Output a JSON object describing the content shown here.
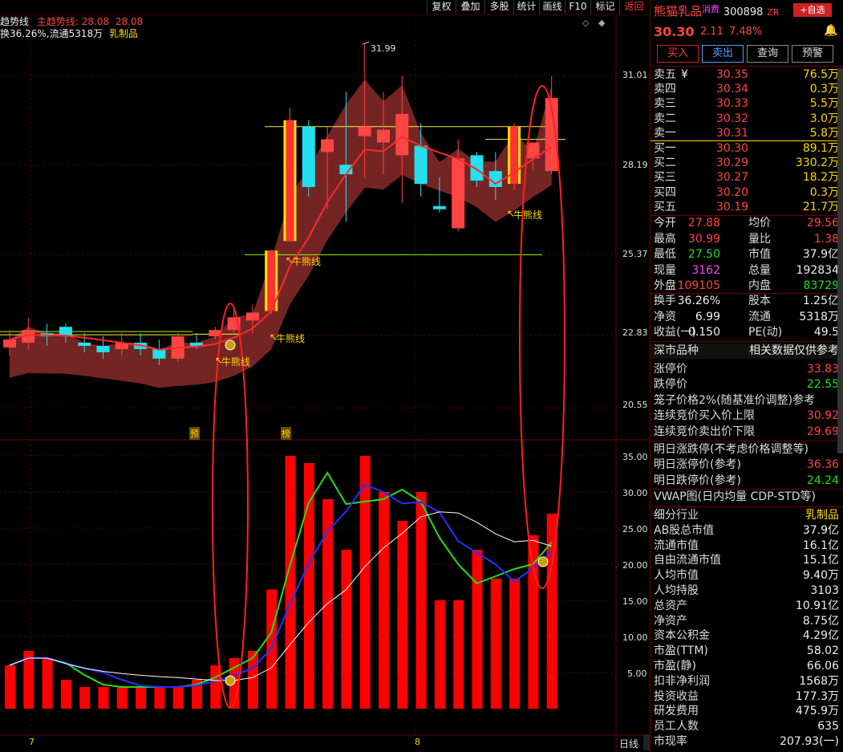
{
  "toolbar": {
    "items": [
      "复权",
      "叠加",
      "多股",
      "统计",
      "画线",
      "F10",
      "标记",
      "返回"
    ]
  },
  "indicator": {
    "main_name": "趋势线",
    "main_label": "主趋势线",
    "main_value": "28.08",
    "second_value": "28.08",
    "line2": "换36.26%,流通5318万",
    "sector": "乳制品"
  },
  "price_axis": [
    "31.01",
    "28.19",
    "25.37",
    "22.83",
    "20.55"
  ],
  "vol_axis": [
    "35.00",
    "30.00",
    "25.00",
    "20.00",
    "15.00",
    "10.00",
    "5.00"
  ],
  "chart_annotations": {
    "high": "31.99",
    "bull1": "牛熊线",
    "bull2": "牛熊线",
    "bull3": "牛熊线",
    "bull4": "牛熊线",
    "tag_yu": "预",
    "tag_bang": "榜",
    "month7": "7",
    "month8": "8",
    "period": "日线"
  },
  "stock": {
    "name": "熊猫乳品",
    "tag": "消费",
    "code": "300898",
    "zr": "ZR",
    "add_label": "+自选",
    "price": "30.30",
    "change": "2.11",
    "pct": "7.48%"
  },
  "actions": [
    "买入",
    "卖出",
    "查询",
    "预警"
  ],
  "sell": [
    {
      "l": "卖五",
      "p": "30.35",
      "v": "76.5万",
      "y": "¥"
    },
    {
      "l": "卖四",
      "p": "30.34",
      "v": "0.3万"
    },
    {
      "l": "卖三",
      "p": "30.33",
      "v": "5.5万"
    },
    {
      "l": "卖二",
      "p": "30.32",
      "v": "3.0万"
    },
    {
      "l": "卖一",
      "p": "30.31",
      "v": "5.8万"
    }
  ],
  "buy": [
    {
      "l": "买一",
      "p": "30.30",
      "v": "89.1万"
    },
    {
      "l": "买二",
      "p": "30.29",
      "v": "330.2万"
    },
    {
      "l": "买三",
      "p": "30.27",
      "v": "18.2万"
    },
    {
      "l": "买四",
      "p": "30.20",
      "v": "0.3万"
    },
    {
      "l": "买五",
      "p": "30.19",
      "v": "21.7万"
    }
  ],
  "stats": [
    {
      "l1": "今开",
      "v1": "27.88",
      "c1": "red",
      "l2": "均价",
      "v2": "29.56",
      "c2": "red"
    },
    {
      "l1": "最高",
      "v1": "30.99",
      "c1": "red",
      "l2": "量比",
      "v2": "1.38",
      "c2": "red"
    },
    {
      "l1": "最低",
      "v1": "27.50",
      "c1": "grn",
      "l2": "市值",
      "v2": "37.9亿",
      "c2": "wht"
    },
    {
      "l1": "现量",
      "v1": "3162",
      "c1": "mag",
      "l2": "总量",
      "v2": "192834",
      "c2": "wht"
    },
    {
      "l1": "外盘",
      "v1": "109105",
      "c1": "red",
      "l2": "内盘",
      "v2": "83729",
      "c2": "grn"
    }
  ],
  "stats2": [
    {
      "l1": "换手",
      "v1": "36.26%",
      "l2": "股本",
      "v2": "1.25亿"
    },
    {
      "l1": "净资",
      "v1": "6.99",
      "l2": "流通",
      "v2": "5318万"
    },
    {
      "l1": "收益(一)",
      "v1": "0.150",
      "l2": "PE(动)",
      "v2": "49.5"
    }
  ],
  "market": {
    "title": "深市品种",
    "note": "相关数据仅供参考"
  },
  "limits": [
    {
      "l": "涨停价",
      "v": "33.83",
      "c": "red"
    },
    {
      "l": "跌停价",
      "v": "22.55",
      "c": "grn"
    }
  ],
  "cage": {
    "title": "笼子价格2%(随基准价调整)参考",
    "rows": [
      {
        "l": "连续竞价买入价上限",
        "v": "30.92",
        "c": "red"
      },
      {
        "l": "连续竞价卖出价下限",
        "v": "29.69",
        "c": "red"
      }
    ]
  },
  "tomorrow": {
    "title": "明日涨跌停(不考虑价格调整等)",
    "rows": [
      {
        "l": "明日涨停价(参考)",
        "v": "36.36",
        "c": "red"
      },
      {
        "l": "明日跌停价(参考)",
        "v": "24.24",
        "c": "grn"
      }
    ]
  },
  "vwap": {
    "title": "VWAP图(日内均量 CDP-STD等)"
  },
  "fund": [
    {
      "l": "细分行业",
      "v": "乳制品",
      "c": "yel"
    },
    {
      "l": "AB股总市值",
      "v": "37.9亿"
    },
    {
      "l": "流通市值",
      "v": "16.1亿"
    },
    {
      "l": "自由流通市值",
      "v": "15.1亿"
    },
    {
      "l": "人均市值",
      "v": "9.40万"
    },
    {
      "l": "人均持股",
      "v": "3103"
    },
    {
      "l": "总资产",
      "v": "10.91亿"
    },
    {
      "l": "净资产",
      "v": "8.75亿"
    },
    {
      "l": "资本公积金",
      "v": "4.29亿"
    },
    {
      "l": "市盈(TTM)",
      "v": "58.02"
    },
    {
      "l": "市盈(静)",
      "v": "66.06"
    },
    {
      "l": "扣非净利润",
      "v": "1568万"
    },
    {
      "l": "投资收益",
      "v": "177.3万"
    },
    {
      "l": "研发费用",
      "v": "475.9万"
    },
    {
      "l": "员工人数",
      "v": "635"
    },
    {
      "l": "市现率",
      "v": "207.93(一)"
    }
  ],
  "chart_data": {
    "type": "candlestick",
    "price_ticks": [
      31.01,
      28.19,
      25.37,
      22.83,
      20.55
    ],
    "volume_ticks": [
      35,
      30,
      25,
      20,
      15,
      10,
      5
    ],
    "candles": [
      {
        "o": 22.45,
        "h": 23.0,
        "l": 22.2,
        "c": 22.7
      },
      {
        "o": 22.6,
        "h": 23.4,
        "l": 22.4,
        "c": 23.0
      },
      {
        "o": 22.9,
        "h": 23.2,
        "l": 22.5,
        "c": 22.8
      },
      {
        "o": 23.1,
        "h": 23.2,
        "l": 22.6,
        "c": 22.8
      },
      {
        "o": 22.6,
        "h": 22.9,
        "l": 22.3,
        "c": 22.5
      },
      {
        "o": 22.5,
        "h": 22.8,
        "l": 22.1,
        "c": 22.3
      },
      {
        "o": 22.4,
        "h": 22.9,
        "l": 22.2,
        "c": 22.6
      },
      {
        "o": 22.6,
        "h": 22.9,
        "l": 22.2,
        "c": 22.4
      },
      {
        "o": 22.4,
        "h": 22.7,
        "l": 21.9,
        "c": 22.1
      },
      {
        "o": 22.1,
        "h": 22.9,
        "l": 22.0,
        "c": 22.8
      },
      {
        "o": 22.6,
        "h": 22.9,
        "l": 22.4,
        "c": 22.5
      },
      {
        "o": 22.8,
        "h": 23.1,
        "l": 22.7,
        "c": 23.0
      },
      {
        "o": 23.0,
        "h": 23.7,
        "l": 22.9,
        "c": 23.4
      },
      {
        "o": 23.3,
        "h": 23.8,
        "l": 22.9,
        "c": 23.55
      },
      {
        "o": 23.6,
        "h": 25.5,
        "l": 23.5,
        "c": 25.5
      },
      {
        "o": 25.8,
        "h": 30.0,
        "l": 25.8,
        "c": 29.6
      },
      {
        "o": 29.4,
        "h": 29.6,
        "l": 27.2,
        "c": 27.5
      },
      {
        "o": 28.6,
        "h": 29.4,
        "l": 26.8,
        "c": 29.0
      },
      {
        "o": 28.2,
        "h": 30.5,
        "l": 26.4,
        "c": 27.9
      },
      {
        "o": 29.1,
        "h": 31.99,
        "l": 27.8,
        "c": 29.4
      },
      {
        "o": 28.9,
        "h": 30.5,
        "l": 27.9,
        "c": 29.3
      },
      {
        "o": 28.5,
        "h": 31.0,
        "l": 27.0,
        "c": 29.8
      },
      {
        "o": 28.8,
        "h": 29.5,
        "l": 27.2,
        "c": 27.6
      },
      {
        "o": 26.9,
        "h": 27.8,
        "l": 26.7,
        "c": 26.8
      },
      {
        "o": 26.2,
        "h": 29.0,
        "l": 26.1,
        "c": 28.4
      },
      {
        "o": 28.5,
        "h": 28.6,
        "l": 27.5,
        "c": 27.7
      },
      {
        "o": 28.0,
        "h": 28.6,
        "l": 27.1,
        "c": 27.5
      },
      {
        "o": 27.6,
        "h": 29.5,
        "l": 27.4,
        "c": 29.4
      },
      {
        "o": 28.4,
        "h": 28.9,
        "l": 28.0,
        "c": 28.9
      },
      {
        "o": 28.0,
        "h": 31.0,
        "l": 27.9,
        "c": 30.3
      }
    ],
    "volumes": [
      6,
      8,
      7,
      4,
      3,
      3,
      3,
      3,
      3,
      3,
      4,
      6,
      7,
      8,
      16.5,
      35,
      34,
      29,
      22,
      35,
      30,
      26,
      30,
      15,
      15,
      22,
      18,
      18,
      24,
      27
    ]
  }
}
